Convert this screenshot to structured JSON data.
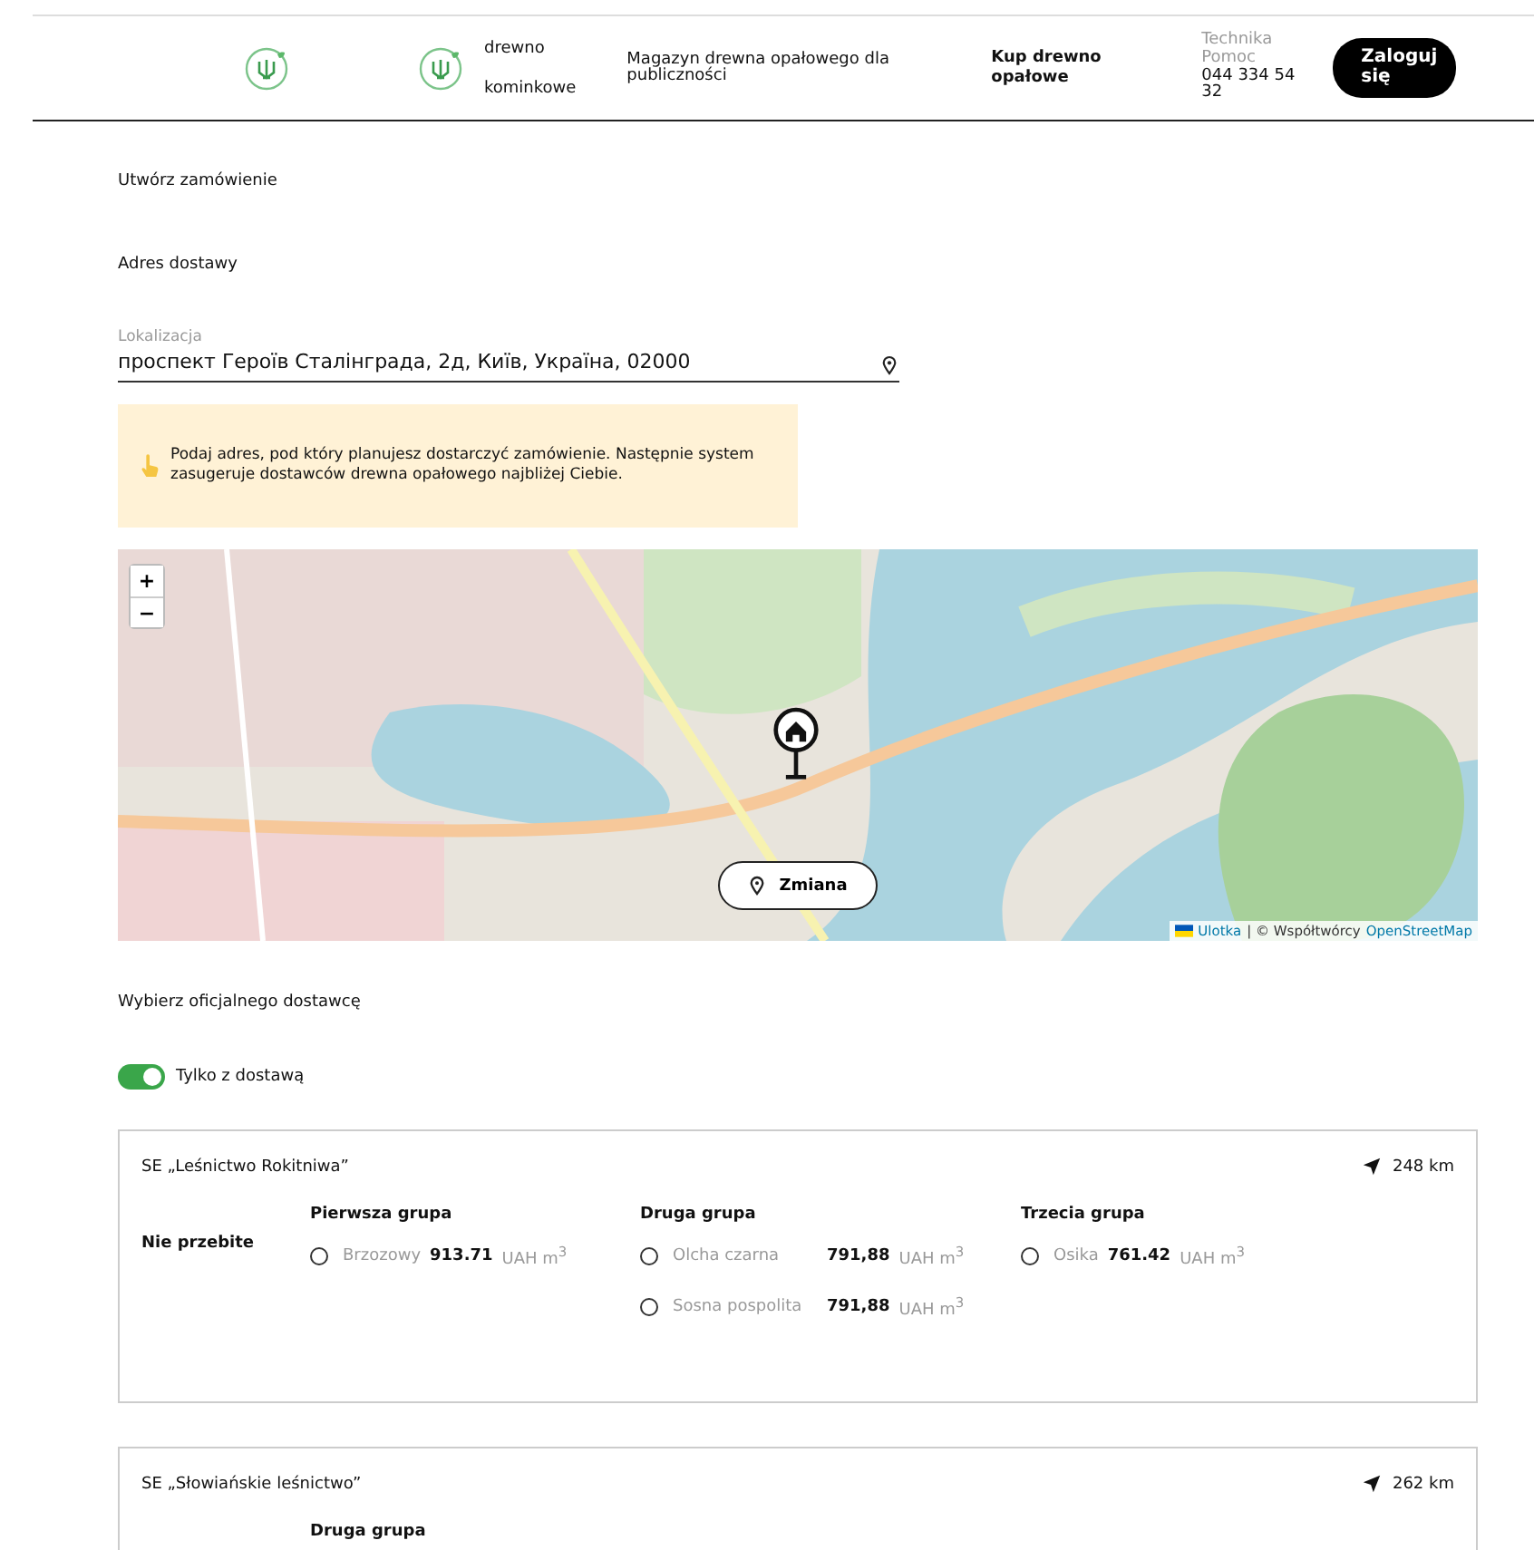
{
  "header": {
    "brand_lines": [
      "drewno",
      "kominkowe"
    ],
    "tagline": "Magazyn drewna opałowego dla publiczności",
    "nav_link": "Kup drewno opałowe",
    "support": {
      "title": "Technika",
      "subtitle": "Pomoc",
      "phone": "044 334 54 32"
    },
    "login_button": "Zaloguj się"
  },
  "page_title": "Utwórz zamówienie",
  "section_title": "Adres dostawy",
  "location": {
    "label": "Lokalizacja",
    "value": "проспект Героїв Сталінграда, 2д, Київ, Україна, 02000"
  },
  "hint": "Podaj adres, pod który planujesz dostarczyć zamówienie. Następnie system zasugeruje dostawców drewna opałowego najbliżej Ciebie.",
  "map": {
    "zoom_in": "+",
    "zoom_out": "−",
    "change_button": "Zmiana",
    "attribution": {
      "link_1": "Ulotka",
      "text": "| © Współtwórcy",
      "link_2": "OpenStreetMap"
    }
  },
  "supplier_heading": "Wybierz oficjalnego dostawcę",
  "delivery_toggle": {
    "label": "Tylko z dostawą",
    "on": true
  },
  "suppliers": [
    {
      "name": "SE „Leśnictwo Rokitniwa”",
      "distance": "248 km",
      "status": "Nie przebite",
      "groups": [
        {
          "title": "Pierwsza grupa",
          "options": [
            {
              "name": "Brzozowy",
              "price": "913.71",
              "unit": "UAH m$^{3}$",
              "selected": false
            }
          ]
        },
        {
          "title": "Druga grupa",
          "options": [
            {
              "name": "Olcha czarna",
              "price": "791,88",
              "unit": "UAH m$^{3}$",
              "selected": false
            },
            {
              "name": "Sosna pospolita",
              "price": "791,88",
              "unit": "UAH m$^{3}$",
              "selected": false
            }
          ]
        },
        {
          "title": "Trzecia grupa",
          "options": [
            {
              "name": "Osika",
              "price": "761.42",
              "unit": "UAH m$^{3}$",
              "selected": false
            }
          ]
        }
      ]
    },
    {
      "name": "SE „Słowiańskie leśnictwo”",
      "distance": "262 km",
      "groups": [
        {
          "title": "Druga grupa"
        }
      ]
    }
  ]
}
